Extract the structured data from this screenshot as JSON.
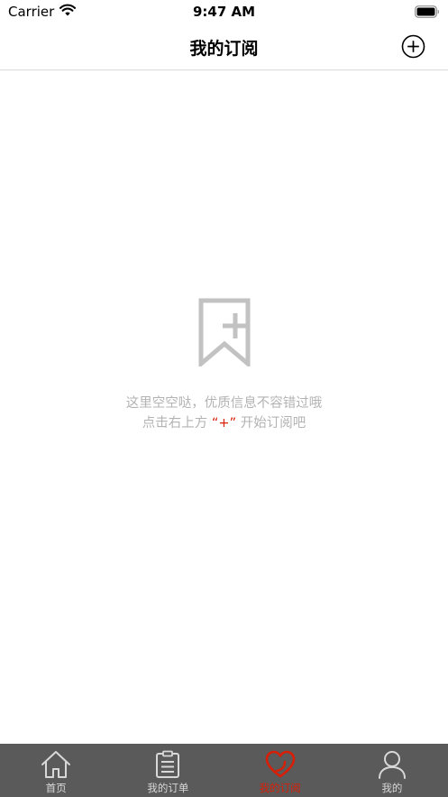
{
  "status_bar": {
    "carrier": "Carrier",
    "time": "9:47 AM"
  },
  "nav": {
    "title": "我的订阅",
    "add_icon": "plus-circle-icon"
  },
  "empty_state": {
    "icon": "bookmark-add-icon",
    "line1": "这里空空哒，优质信息不容错过哦",
    "line2_prefix": "点击右上方",
    "line2_highlight": "“+”",
    "line2_suffix": "开始订阅吧"
  },
  "tabs": [
    {
      "label": "首页",
      "icon": "home-icon",
      "active": false
    },
    {
      "label": "我的订单",
      "icon": "clipboard-icon",
      "active": false
    },
    {
      "label": "我的订阅",
      "icon": "heart-subscribe-icon",
      "active": true
    },
    {
      "label": "我的",
      "icon": "person-icon",
      "active": false
    }
  ],
  "colors": {
    "accent": "#d81e06",
    "tab_bar_bg": "#5a5a5a",
    "tab_icon": "#d8d8d8",
    "empty_text": "#b3b3b3",
    "empty_icon": "#c2c2c2"
  }
}
